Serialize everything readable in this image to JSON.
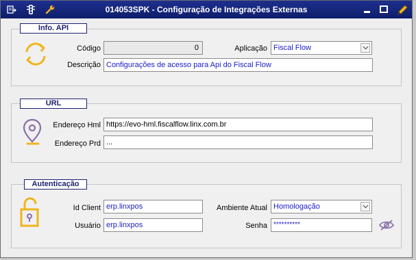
{
  "window": {
    "title": "014053SPK - Configuração de Integrações Externas"
  },
  "toolbar_icons": [
    "export-icon",
    "traffic-light-icon",
    "wrench-icon"
  ],
  "window_controls": [
    "minimize-icon",
    "maximize-icon",
    "edit-pencil-icon"
  ],
  "info_api": {
    "legend": "Info. API",
    "icon": "refresh-icon",
    "codigo_label": "Código",
    "codigo_value": "0",
    "aplicacao_label": "Aplicação",
    "aplicacao_value": "Fiscal Flow",
    "descricao_label": "Descrição",
    "descricao_value": "Configurações de acesso para Api do Fiscal Flow"
  },
  "url": {
    "legend": "URL",
    "icon": "location-pin-icon",
    "hml_label": "Endereço Hml",
    "hml_value": "https://evo-hml.fiscalflow.linx.com.br",
    "prd_label": "Endereço Prd",
    "prd_value": "..."
  },
  "autenticacao": {
    "legend": "Autenticação",
    "icon": "unlocked-padlock-icon",
    "id_client_label": "Id Client",
    "id_client_value": "erp.linxpos",
    "ambiente_label": "Ambiente Atual",
    "ambiente_value": "Homologação",
    "usuario_label": "Usuário",
    "usuario_value": "erp.linxpos",
    "senha_label": "Senha",
    "senha_value": "**********",
    "toggle_icon": "eye-slash-icon"
  },
  "colors": {
    "titlebar": "#1d2f8e",
    "legend_border": "#1b1f6e",
    "field_text": "#1a1ac8",
    "icon_accent": "#f0b41e"
  }
}
